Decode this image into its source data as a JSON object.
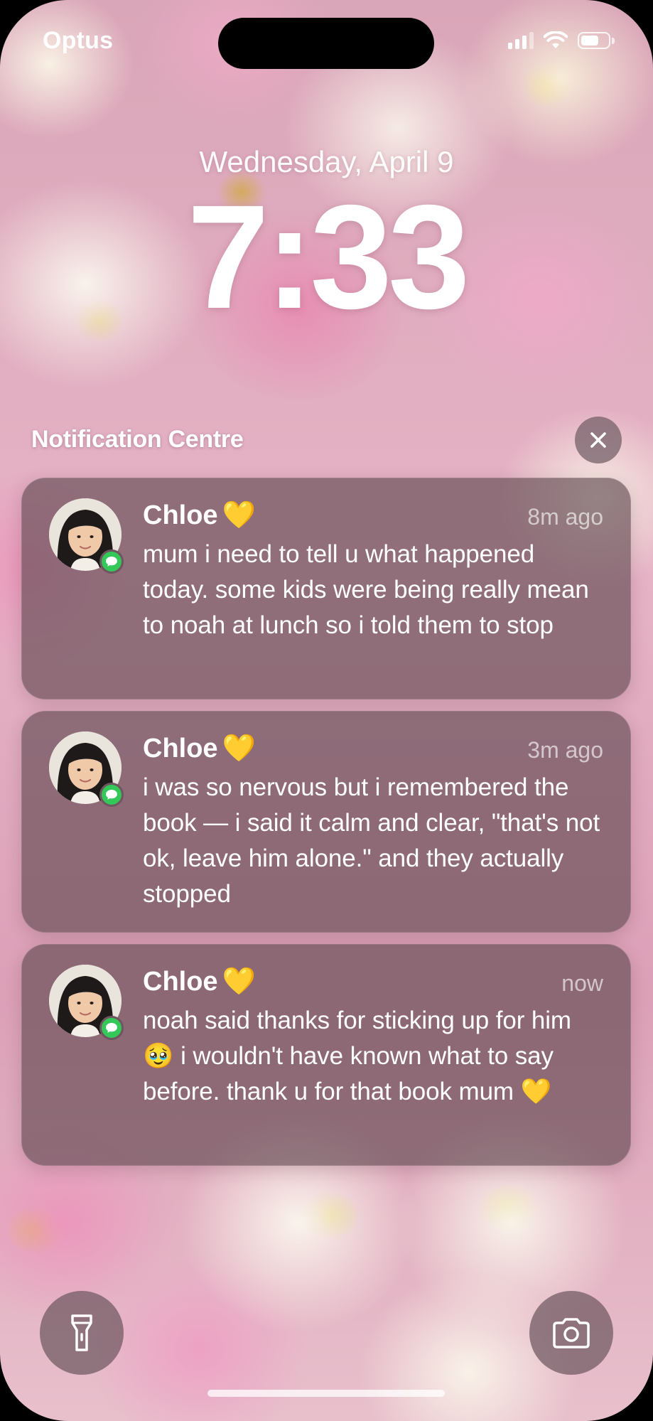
{
  "status_bar": {
    "carrier": "Optus",
    "battery_level": 0.72,
    "signal_bars": 3,
    "icons": [
      "cellular-signal-icon",
      "wifi-icon",
      "battery-icon"
    ]
  },
  "lock_screen": {
    "date": "Wednesday, April 9",
    "time": "7:33"
  },
  "notification_centre": {
    "title": "Notification Centre",
    "clear_icon": "close-icon"
  },
  "notifications": [
    {
      "sender": "Chloe",
      "emoji": "💛",
      "time": "8m ago",
      "message": "mum i need to tell u what happened today. some kids were being really mean to noah at lunch so i told them to stop",
      "app_icon": "messages-icon"
    },
    {
      "sender": "Chloe",
      "emoji": "💛",
      "time": "3m ago",
      "message": "i was so nervous but i remembered the book — i said it calm and clear, \"that's not ok, leave him alone.\" and they actually stopped",
      "app_icon": "messages-icon"
    },
    {
      "sender": "Chloe",
      "emoji": "💛",
      "time": "now",
      "message": "noah said thanks for sticking up for him 🥹 i wouldn't have known what to say before. thank u for that book mum 💛",
      "app_icon": "messages-icon"
    }
  ],
  "bottom_controls": {
    "left_icon": "flashlight-icon",
    "right_icon": "camera-icon"
  }
}
